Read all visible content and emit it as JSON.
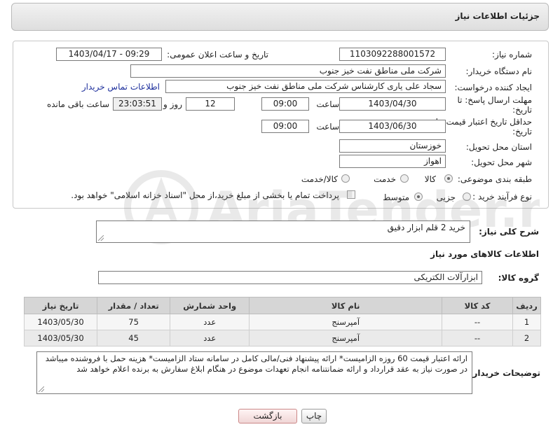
{
  "header": {
    "title": "جزئیات اطلاعات نیاز"
  },
  "form": {
    "need_number": {
      "label": "شماره نیاز:",
      "value": "1103092288001572"
    },
    "announce": {
      "label": "تاریخ و ساعت اعلان عمومی:",
      "value": "1403/04/17 - 09:29"
    },
    "buyer_org": {
      "label": "نام دستگاه خریدار:",
      "value": "شرکت ملی مناطق نفت خیز جنوب"
    },
    "creator": {
      "label": "ایجاد کننده درخواست:",
      "value": "سجاد علی یاری کارشناس شرکت ملی مناطق نفت خیز جنوب",
      "contact_link": "اطلاعات تماس خریدار"
    },
    "deadline": {
      "label_line1": "مهلت ارسال پاسخ: تا",
      "label_line2": "تاریخ:",
      "date": "1403/04/30",
      "time_label": "ساعت",
      "time": "09:00",
      "days": "12",
      "days_label": "روز و",
      "remaining": "23:03:51",
      "remaining_label": "ساعت باقی مانده"
    },
    "validity": {
      "label_line1": "حداقل تاریخ اعتبار قیمت: تا",
      "label_line2": "تاریخ:",
      "date": "1403/06/30",
      "time_label": "ساعت",
      "time": "09:00"
    },
    "province": {
      "label": "استان محل تحویل:",
      "value": "خوزستان"
    },
    "city": {
      "label": "شهر محل تحویل:",
      "value": "اهواز"
    },
    "category": {
      "label": "طبقه بندی موضوعی:",
      "options": [
        "کالا",
        "خدمت",
        "کالا/خدمت"
      ],
      "selected": "کالا"
    },
    "purchase_type": {
      "label": "نوع فرآیند خرید :",
      "options": [
        "جزیی",
        "متوسط"
      ],
      "selected": "متوسط",
      "payment_note": "پرداخت تمام یا بخشی از مبلغ خرید،از محل \"اسناد خزانه اسلامی\" خواهد بود."
    }
  },
  "description": {
    "label": "شرح کلی نیاز:",
    "value": "خرید 2 قلم ابزار دقیق"
  },
  "goods_section": {
    "title": "اطلاعات کالاهای مورد نیاز"
  },
  "goods_group": {
    "label": "گروه کالا:",
    "value": "ابزارآلات الکتریکی"
  },
  "table": {
    "headers": [
      "ردیف",
      "کد کالا",
      "نام کالا",
      "واحد شمارش",
      "تعداد / مقدار",
      "تاریخ نیاز"
    ],
    "rows": [
      [
        "1",
        "--",
        "آمپرسنج",
        "عدد",
        "75",
        "1403/05/30"
      ],
      [
        "2",
        "--",
        "آمپرسنج",
        "عدد",
        "45",
        "1403/05/30"
      ]
    ]
  },
  "buyer_notes": {
    "label": "توضیحات خریدار:",
    "line1": "ارائه اعتبار قیمت 60 روزه الزامیست* ارائه پیشنهاد فنی/مالی کامل در سامانه ستاد الزامیست* هزینه حمل با فروشنده میباشد",
    "line2": "در صورت نیاز به عقد قرارداد و ارائه ضمانتنامه انجام تعهدات موضوع در هنگام ابلاغ سفارش به برنده اعلام خواهد شد"
  },
  "buttons": {
    "print": "چاپ",
    "back": "بازگشت"
  },
  "watermark": {
    "text": "AriaTender.neT"
  }
}
